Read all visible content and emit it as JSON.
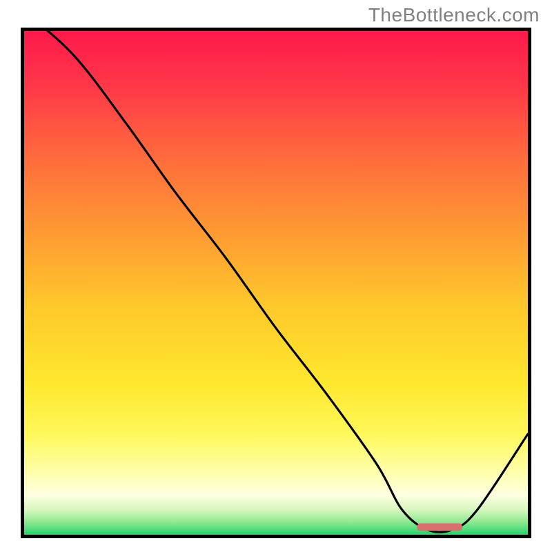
{
  "watermark": "TheBottleneck.com",
  "chart_data": {
    "type": "line",
    "title": "",
    "xlabel": "",
    "ylabel": "",
    "xlim": [
      0,
      100
    ],
    "ylim": [
      0,
      100
    ],
    "curve": {
      "name": "bottleneck-curve",
      "x": [
        0,
        10,
        20,
        30,
        40,
        50,
        60,
        70,
        75,
        80,
        85,
        90,
        100
      ],
      "y": [
        104,
        95,
        82,
        68,
        55,
        41,
        28,
        14,
        5,
        1,
        1,
        5,
        20
      ]
    },
    "marker": {
      "name": "optimal-range",
      "x_start": 78,
      "x_end": 87,
      "y": 1.5,
      "color": "#d9706d"
    },
    "gradient_stops": [
      {
        "offset": 0.0,
        "color": "#ff1a4b"
      },
      {
        "offset": 0.1,
        "color": "#ff3449"
      },
      {
        "offset": 0.25,
        "color": "#ff6b3d"
      },
      {
        "offset": 0.4,
        "color": "#ff9a33"
      },
      {
        "offset": 0.55,
        "color": "#ffc92b"
      },
      {
        "offset": 0.7,
        "color": "#ffe82e"
      },
      {
        "offset": 0.8,
        "color": "#fff85a"
      },
      {
        "offset": 0.88,
        "color": "#ffffb0"
      },
      {
        "offset": 0.92,
        "color": "#ffffe0"
      },
      {
        "offset": 0.95,
        "color": "#d8f7c0"
      },
      {
        "offset": 0.975,
        "color": "#8fe890"
      },
      {
        "offset": 1.0,
        "color": "#24d36a"
      }
    ]
  }
}
